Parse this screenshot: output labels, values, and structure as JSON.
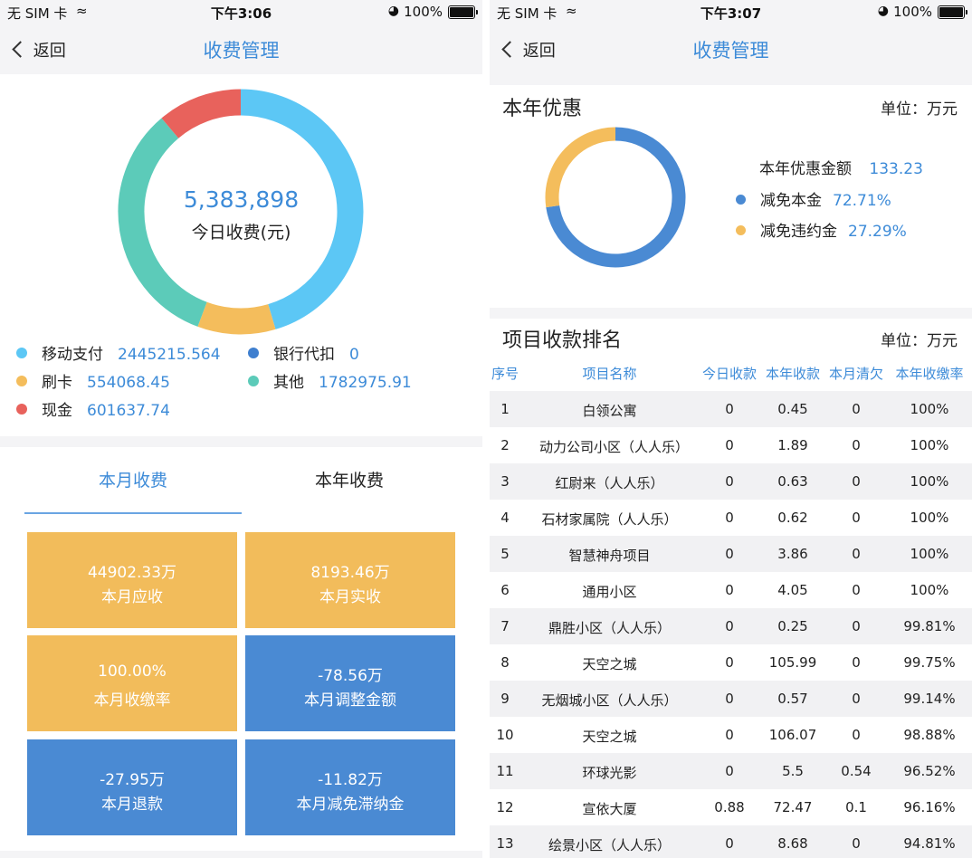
{
  "left": {
    "status": {
      "carrier": "无 SIM 卡",
      "time": "下午3:06",
      "battery": "100%"
    },
    "nav": {
      "back_label": "返回",
      "title": "收费管理"
    },
    "today": {
      "amount": "5,383,898",
      "label": "今日收费(元)"
    },
    "donut_slices": [
      {
        "name": "移动支付",
        "value": 2445215.564,
        "color": "#5cc7f5"
      },
      {
        "name": "刷卡",
        "value": 554068.45,
        "color": "#f4bd5c"
      },
      {
        "name": "其他",
        "value": 1782975.91,
        "color": "#5ccbb9"
      },
      {
        "name": "现金",
        "value": 601637.74,
        "color": "#e8625c"
      }
    ],
    "legend": [
      {
        "name": "移动支付",
        "value": "2445215.564",
        "color": "#5cc7f5"
      },
      {
        "name": "银行代扣",
        "value": "0",
        "color": "#3f7fcf"
      },
      {
        "name": "刷卡",
        "value": "554068.45",
        "color": "#f4bd5c"
      },
      {
        "name": "其他",
        "value": "1782975.91",
        "color": "#5ccbb9"
      },
      {
        "name": "现金",
        "value": "601637.74",
        "color": "#e8625c"
      }
    ],
    "tabs": [
      {
        "label": "本月收费",
        "active": true
      },
      {
        "label": "本年收费",
        "active": false
      }
    ],
    "tiles": [
      {
        "value": "44902.33万",
        "label": "本月应收"
      },
      {
        "value": "8193.46万",
        "label": "本月实收"
      },
      {
        "value": "100.00%",
        "label": "本月收缴率"
      },
      {
        "value": "-78.56万",
        "label": "本月调整金额"
      },
      {
        "value": "-27.95万",
        "label": "本月退款"
      },
      {
        "value": "-11.82万",
        "label": "本月减免滞纳金"
      }
    ]
  },
  "right": {
    "status": {
      "carrier": "无 SIM 卡",
      "time": "下午3:07",
      "battery": "100%"
    },
    "nav": {
      "back_label": "返回",
      "title": "收费管理"
    },
    "discount": {
      "title": "本年优惠",
      "unit": "单位：万元",
      "total_label": "本年优惠金额",
      "total_value": "133.23",
      "items": [
        {
          "name": "减免本金",
          "value": "72.71%",
          "percent": 72.71,
          "color": "#4a8ad3"
        },
        {
          "name": "减免违约金",
          "value": "27.29%",
          "percent": 27.29,
          "color": "#f4bd5c"
        }
      ]
    },
    "ranking": {
      "title": "项目收款排名",
      "unit": "单位：万元",
      "headers": [
        "序号",
        "项目名称",
        "今日收款",
        "本年收款",
        "本月清欠",
        "本年收缴率"
      ],
      "rows": [
        [
          "1",
          "白领公寓",
          "0",
          "0.45",
          "0",
          "100%"
        ],
        [
          "2",
          "动力公司小区（人人乐）",
          "0",
          "1.89",
          "0",
          "100%"
        ],
        [
          "3",
          "红尉来（人人乐）",
          "0",
          "0.63",
          "0",
          "100%"
        ],
        [
          "4",
          "石材家属院（人人乐）",
          "0",
          "0.62",
          "0",
          "100%"
        ],
        [
          "5",
          "智慧神舟项目",
          "0",
          "3.86",
          "0",
          "100%"
        ],
        [
          "6",
          "通用小区",
          "0",
          "4.05",
          "0",
          "100%"
        ],
        [
          "7",
          "鼎胜小区（人人乐）",
          "0",
          "0.25",
          "0",
          "99.81%"
        ],
        [
          "8",
          "天空之城",
          "0",
          "105.99",
          "0",
          "99.75%"
        ],
        [
          "9",
          "无烟城小区（人人乐）",
          "0",
          "0.57",
          "0",
          "99.14%"
        ],
        [
          "10",
          "天空之城",
          "0",
          "106.07",
          "0",
          "98.88%"
        ],
        [
          "11",
          "环球光影",
          "0",
          "5.5",
          "0.54",
          "96.52%"
        ],
        [
          "12",
          "宣依大厦",
          "0.88",
          "72.47",
          "0.1",
          "96.16%"
        ],
        [
          "13",
          "绘景小区（人人乐）",
          "0",
          "8.68",
          "0",
          "94.81%"
        ]
      ]
    }
  }
}
